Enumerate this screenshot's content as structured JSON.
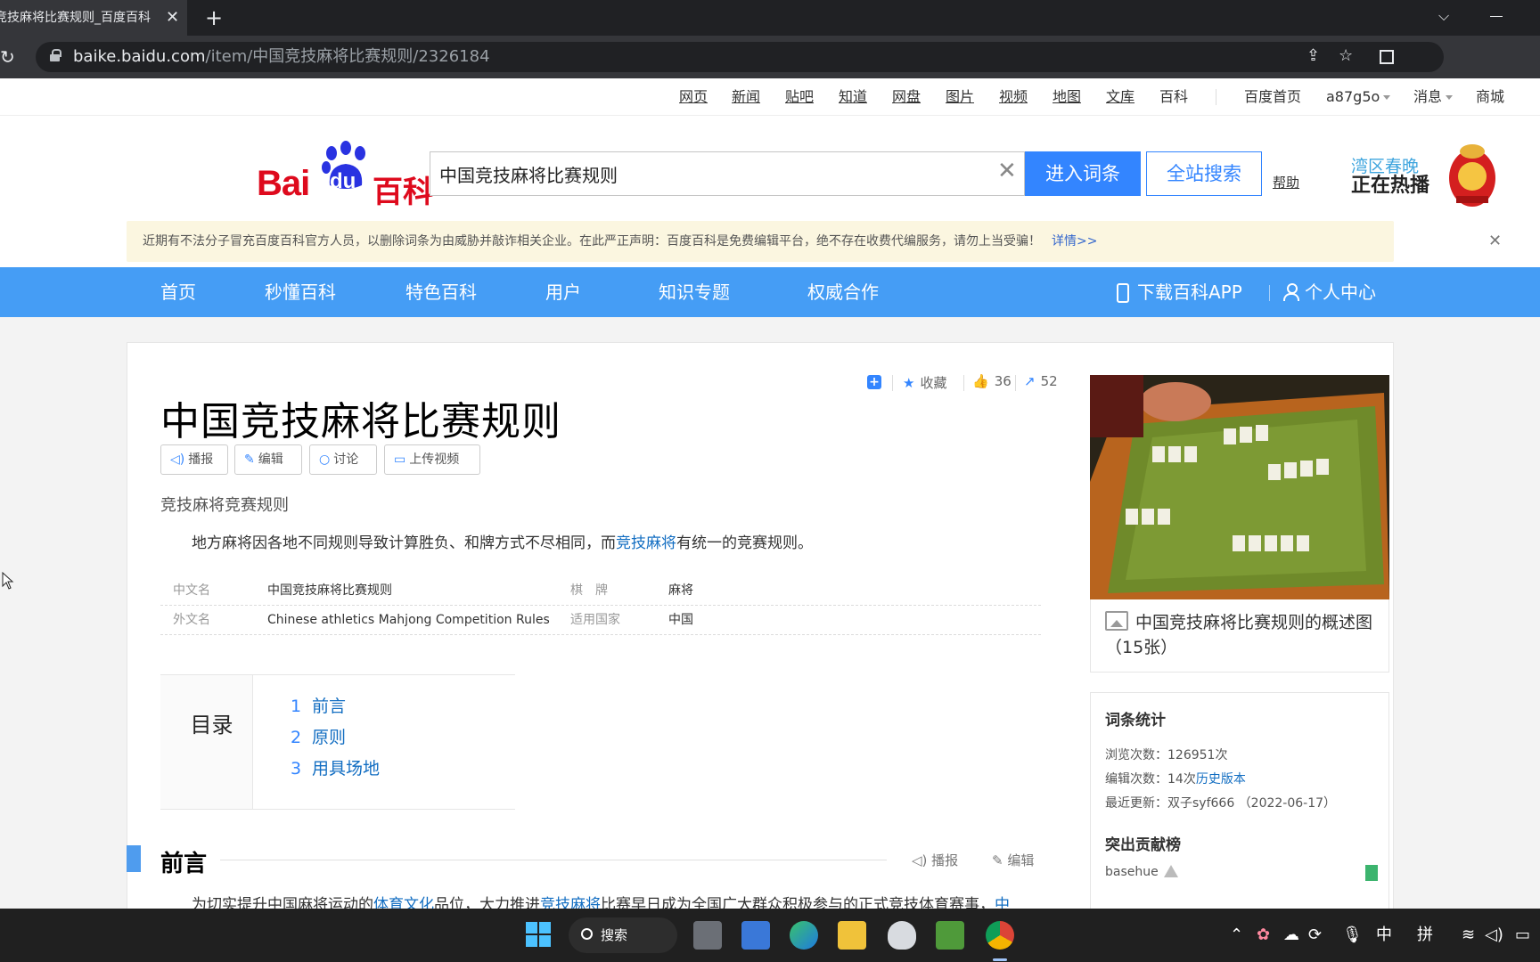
{
  "browser": {
    "tab_title": "竞技麻将比赛规则_百度百科",
    "tab_close": "✕",
    "new_tab": "+",
    "url_host": "baike.baidu.com",
    "url_path": "/item/中国竞技麻将比赛规则/2326184"
  },
  "toplinks": {
    "products": [
      "网页",
      "新闻",
      "贴吧",
      "知道",
      "网盘",
      "图片",
      "视频",
      "地图",
      "文库",
      "百科"
    ],
    "home": "百度首页",
    "user": "a87g5o",
    "messages": "消息",
    "mall": "商城"
  },
  "header": {
    "logo_bai": "Bai",
    "logo_du": "du",
    "logo_baike": "百科",
    "search_value": "中国竞技麻将比赛规则",
    "clear": "✕",
    "enter_button": "进入词条",
    "search_all_button": "全站搜索",
    "help": "帮助",
    "promo_line1": "湾区春晚",
    "promo_line2": "正在热播"
  },
  "notice": {
    "text": "近期有不法分子冒充百度百科官方人员，以删除词条为由威胁并敲诈相关企业。在此严正声明：百度百科是免费编辑平台，绝不存在收费代编服务，请勿上当受骗！",
    "more": "详情>>",
    "close": "✕"
  },
  "nav": {
    "items": [
      "首页",
      "秒懂百科",
      "特色百科",
      "用户",
      "知识专题",
      "权威合作"
    ],
    "download_app": "下载百科APP",
    "personal_center": "个人中心"
  },
  "article": {
    "tools": {
      "add": "+",
      "favorite": "收藏",
      "like_count": "36",
      "share_count": "52"
    },
    "title": "中国竞技麻将比赛规则",
    "actions": [
      "播报",
      "编辑",
      "讨论",
      "上传视频"
    ],
    "subtitle": "竞技麻将竞赛规则",
    "summary_before": "地方麻将因各地不同规则导致计算胜负、和牌方式不尽相同，而",
    "summary_link": "竞技麻将",
    "summary_after": "有统一的竞赛规则。",
    "infobox": [
      {
        "k1": "中文名",
        "v1": "中国竞技麻将比赛规则",
        "k2": "棋　牌",
        "v2": "麻将"
      },
      {
        "k1": "外文名",
        "v1": "Chinese athletics Mahjong Competition Rules",
        "k2": "适用国家",
        "v2": "中国"
      }
    ],
    "toc_label": "目录",
    "toc": [
      {
        "num": "1",
        "label": "前言"
      },
      {
        "num": "2",
        "label": "原则"
      },
      {
        "num": "3",
        "label": "用具场地"
      }
    ],
    "section_title": "前言",
    "section_tools": [
      "播报",
      "编辑"
    ],
    "section_text_1": "为切实提升中国麻将运动的",
    "section_link_1": "体育文化",
    "section_text_2": "品位，大力推进",
    "section_link_2": "竞技麻将",
    "section_text_3": "比赛早日成为全国广大群众积极参与的正式竞技体育赛事，",
    "section_link_3": "中"
  },
  "sidebar": {
    "photo_caption": "中国竞技麻将比赛规则的概述图（15张）",
    "stats_title": "词条统计",
    "views_label": "浏览次数：",
    "views_value": "126951次",
    "edits_label": "编辑次数：",
    "edits_value": "14次",
    "history_link": "历史版本",
    "updated_label": "最近更新：",
    "updated_value": "双子syf666 （2022-06-17）",
    "contrib_title": "突出贡献榜",
    "contributor": "basehue"
  },
  "taskbar": {
    "search": "搜索",
    "ime_1": "中",
    "ime_2": "拼"
  },
  "colors": {
    "nav_blue": "#459df5",
    "button_blue": "#3385ff",
    "logo_red": "#de0a1d",
    "link_blue": "#136ec2"
  }
}
